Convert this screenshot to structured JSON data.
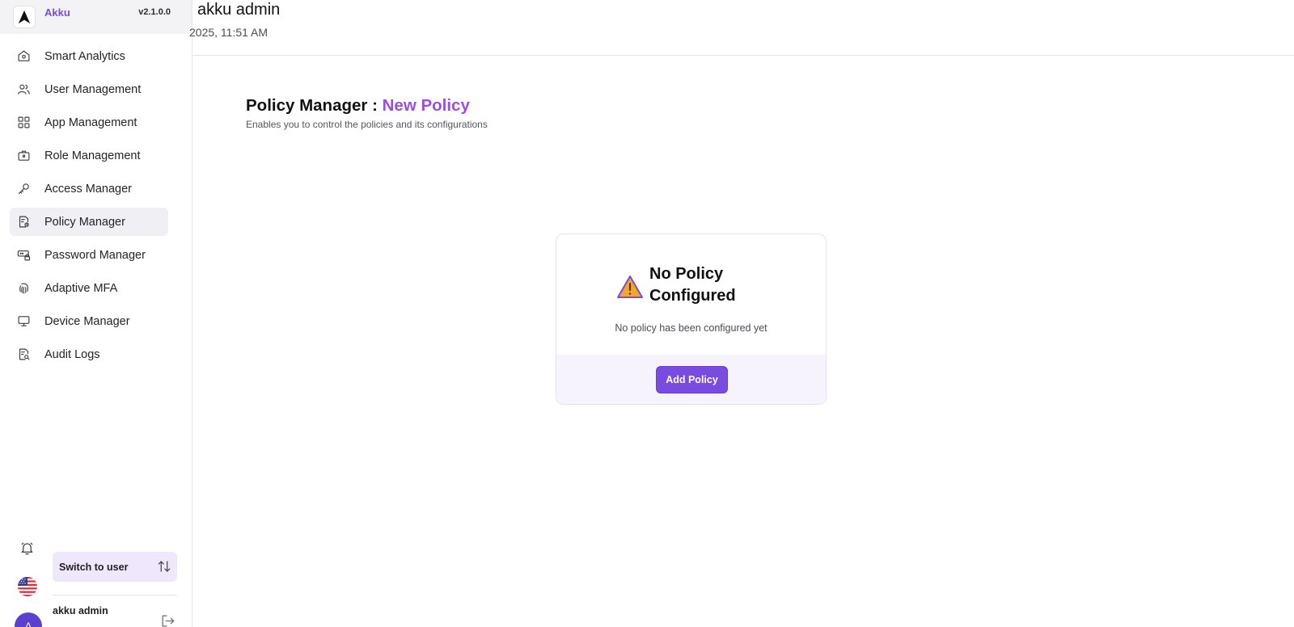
{
  "brand": {
    "name": "Akku",
    "version": "v2.1.0.0"
  },
  "sidebar": {
    "items": [
      {
        "label": "Smart Analytics",
        "icon": "home-icon"
      },
      {
        "label": "User Management",
        "icon": "users-icon"
      },
      {
        "label": "App Management",
        "icon": "grid-icon"
      },
      {
        "label": "Role Management",
        "icon": "briefcase-icon"
      },
      {
        "label": "Access Manager",
        "icon": "key-icon"
      },
      {
        "label": "Policy Manager",
        "icon": "policy-doc-icon",
        "active": true
      },
      {
        "label": "Password Manager",
        "icon": "password-icon"
      },
      {
        "label": "Adaptive MFA",
        "icon": "fingerprint-icon"
      },
      {
        "label": "Device Manager",
        "icon": "monitor-icon"
      },
      {
        "label": "Audit Logs",
        "icon": "audit-doc-icon"
      }
    ],
    "switch_label": "Switch to user",
    "user": {
      "name": "akku admin",
      "avatar_initial": "A"
    }
  },
  "header": {
    "greeting": "akku admin",
    "datetime": "2025, 11:51 AM"
  },
  "main": {
    "title_prefix": "Policy Manager :",
    "title_accent": "New Policy",
    "subtitle": "Enables you to control the policies and its configurations",
    "empty_state": {
      "title": "No Policy Configured",
      "description": "No policy has been configured yet",
      "button_label": "Add Policy",
      "icon": "warning-icon"
    }
  },
  "colors": {
    "accent": "#7a4be0",
    "title_accent": "#9a4ee0",
    "warning": "#f5a623",
    "active_bg": "#efeff4"
  }
}
